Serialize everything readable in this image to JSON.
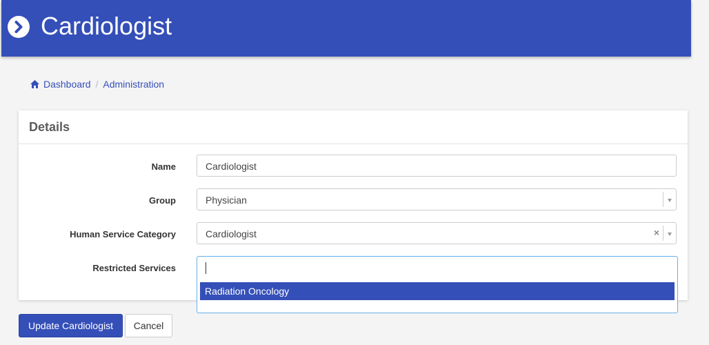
{
  "header": {
    "title": "Cardiologist",
    "icon": "chevron-right-circle-icon",
    "color": "#354fb8"
  },
  "breadcrumb": {
    "items": [
      {
        "label": "Dashboard",
        "icon": "home-icon"
      },
      {
        "label": "Administration"
      }
    ],
    "separator": "/"
  },
  "panel": {
    "title": "Details",
    "fields": {
      "name": {
        "label": "Name",
        "value": "Cardiologist"
      },
      "group": {
        "label": "Group",
        "value": "Physician"
      },
      "category": {
        "label": "Human Service Category",
        "value": "Cardiologist",
        "clear": "×"
      },
      "restricted": {
        "label": "Restricted Services",
        "search_value": "",
        "options": [
          "Radiation Oncology"
        ]
      }
    }
  },
  "actions": {
    "primary": "Update Cardiologist",
    "cancel": "Cancel"
  }
}
